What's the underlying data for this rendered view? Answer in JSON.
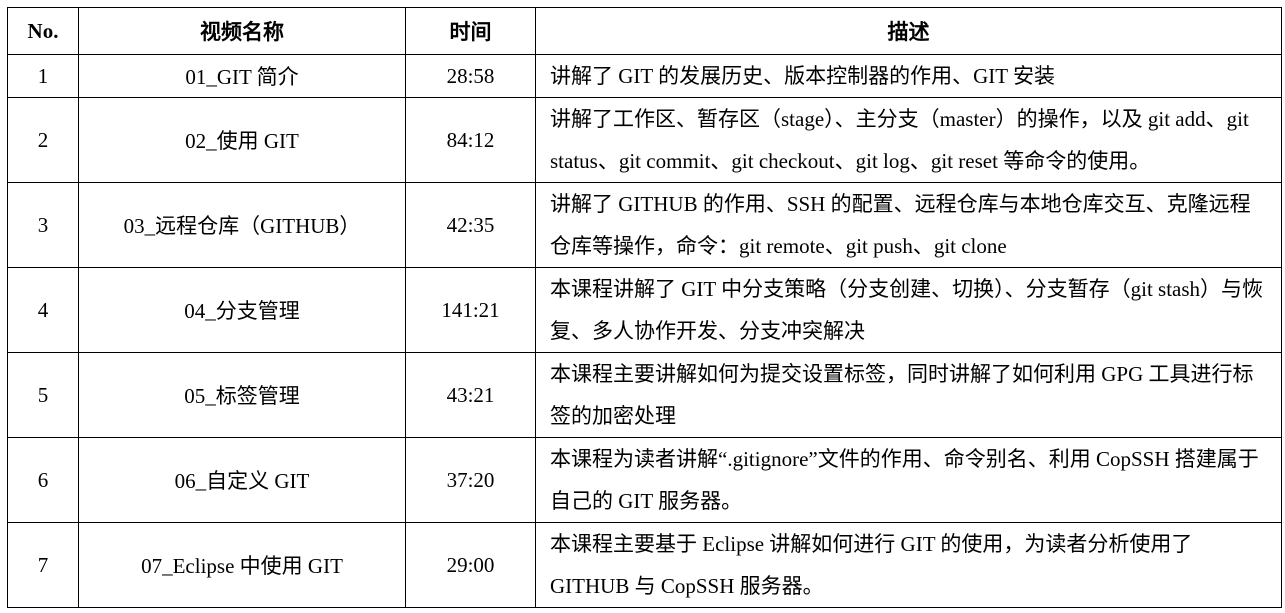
{
  "headers": [
    "No.",
    "视频名称",
    "时间",
    "描述"
  ],
  "rows": [
    {
      "no": "1",
      "name": "01_GIT 简介",
      "time": "28:58",
      "desc": "讲解了 GIT 的发展历史、版本控制器的作用、GIT 安装"
    },
    {
      "no": "2",
      "name": "02_使用 GIT",
      "time": "84:12",
      "desc": "讲解了工作区、暂存区（stage）、主分支（master）的操作，以及 git add、git status、git commit、git checkout、git log、git reset 等命令的使用。"
    },
    {
      "no": "3",
      "name": "03_远程仓库（GITHUB）",
      "time": "42:35",
      "desc": "讲解了 GITHUB 的作用、SSH 的配置、远程仓库与本地仓库交互、克隆远程仓库等操作，命令：git remote、git push、git clone"
    },
    {
      "no": "4",
      "name": "04_分支管理",
      "time": "141:21",
      "desc": "本课程讲解了 GIT 中分支策略（分支创建、切换）、分支暂存（git stash）与恢复、多人协作开发、分支冲突解决"
    },
    {
      "no": "5",
      "name": "05_标签管理",
      "time": "43:21",
      "desc": "本课程主要讲解如何为提交设置标签，同时讲解了如何利用 GPG 工具进行标签的加密处理"
    },
    {
      "no": "6",
      "name": "06_自定义 GIT",
      "time": "37:20",
      "desc": "本课程为读者讲解“.gitignore”文件的作用、命令别名、利用 CopSSH 搭建属于自己的 GIT 服务器。"
    },
    {
      "no": "7",
      "name": "07_Eclipse 中使用 GIT",
      "time": "29:00",
      "desc": "本课程主要基于 Eclipse 讲解如何进行 GIT 的使用，为读者分析使用了 GITHUB 与 CopSSH 服务器。"
    }
  ]
}
